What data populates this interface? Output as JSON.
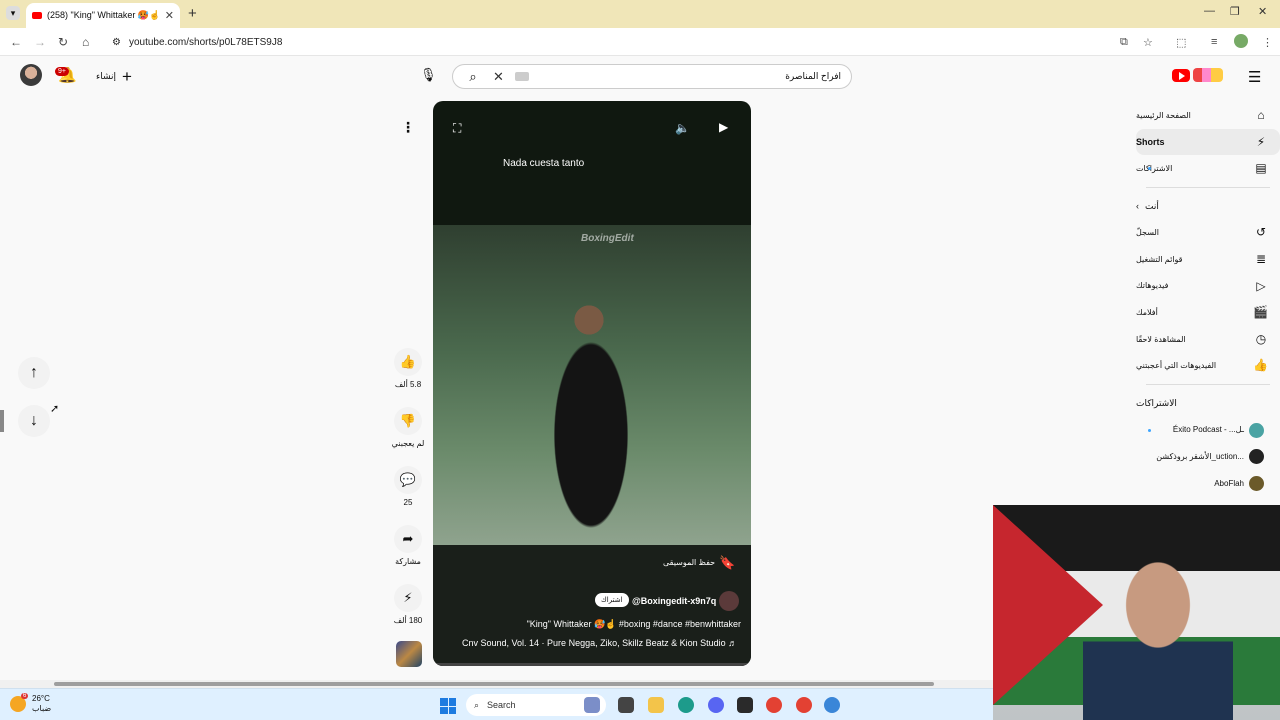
{
  "browser": {
    "tab_title": "(258) \"King\" Whittaker 🥵☝️ #...",
    "tab_close": "✕",
    "new_tab": "+",
    "url": "youtube.com/shorts/p0L78ETS9J8"
  },
  "header": {
    "notification_count": "9+",
    "create_label": "إنشاء",
    "search_query": "افراح المناصرة"
  },
  "sidebar": {
    "home": "الصفحة الرئيسية",
    "shorts": "Shorts",
    "subscriptions": "الاشتراكات",
    "you_heading": "أنت",
    "history": "السجلّ",
    "playlists": "قوائم التشغيل",
    "your_videos": "فيديوهاتك",
    "your_movies": "أفلامك",
    "watch_later": "المشاهدة لاحقًا",
    "liked_videos": "الفيديوهات التي أعجبتني",
    "subs_heading": "الاشتراكات",
    "channels": [
      {
        "name": "Éxito Podcast - ...ـل",
        "color": "#4aa3a3"
      },
      {
        "name": "الأشقر بروذكشن_uction...",
        "color": "#222222"
      },
      {
        "name": "AboFlah",
        "color": "#6b5a2a"
      }
    ]
  },
  "video": {
    "caption": "Nada cuesta tanto",
    "watermark": "BoxingEdit",
    "save_music": "حفظ الموسيقى",
    "subscribe": "اشتراك",
    "channel_handle": "@Boxingedit-x9n7q",
    "title": "\"King\" Whittaker 🥵☝️ #boxing #dance #benwhittaker",
    "music": "Cnv Sound, Vol. 14 · Pure Negga, Ziko, Skillz Beatz & Kion Studio ♬"
  },
  "actions": {
    "likes": "5.8 ألف",
    "dislike": "لم يعجبني",
    "comments": "25",
    "share": "مشاركة",
    "remix": "180 ألف"
  },
  "taskbar": {
    "temperature": "26°C",
    "weather_label": "ضباب",
    "weather_badge": "6",
    "search_label": "Search"
  },
  "colors": {
    "accent": "#ff0000",
    "sidebar_active": "#ebebeb",
    "taskbar": "#dff0ff"
  }
}
